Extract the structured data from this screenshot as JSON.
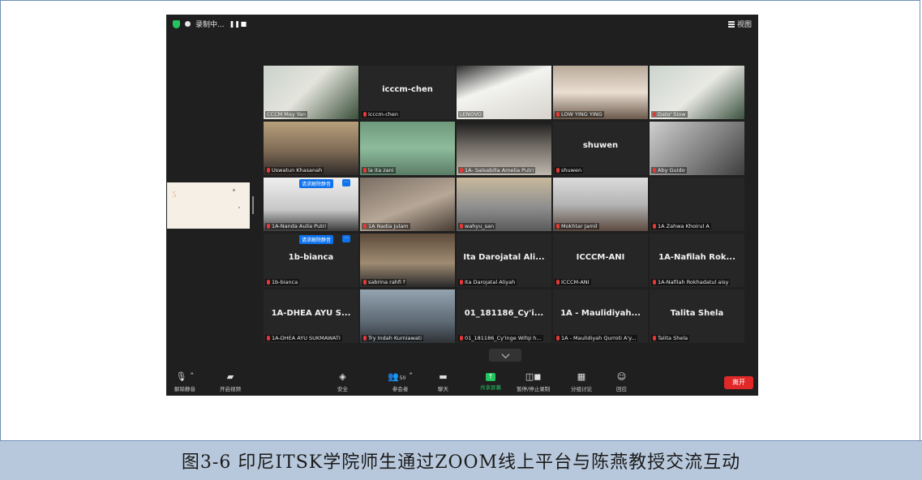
{
  "zoom": {
    "topbar": {
      "recording": "录制中...",
      "view": "视图"
    },
    "tiles": [
      {
        "name": "",
        "label": "CCCM May Yan",
        "video": "v1",
        "active": true,
        "muted": false
      },
      {
        "name": "icccm-chen",
        "label": "icccm-chen",
        "video": "",
        "muted": true
      },
      {
        "name": "",
        "label": "LENOVO",
        "video": "v2",
        "muted": false
      },
      {
        "name": "",
        "label": "LOW YING YING",
        "video": "v3",
        "muted": true
      },
      {
        "name": "",
        "label": "Dato' Siow",
        "video": "v4",
        "muted": true
      },
      {
        "name": "",
        "label": "Uswatun Khasanah",
        "video": "v5",
        "muted": true
      },
      {
        "name": "",
        "label": "la ita zani",
        "video": "v6",
        "muted": true
      },
      {
        "name": "",
        "label": "1A- Salsabilla Amelia Putri",
        "video": "v7",
        "muted": true
      },
      {
        "name": "shuwen",
        "label": "shuwen",
        "video": "",
        "muted": true
      },
      {
        "name": "",
        "label": "Aby Guido",
        "video": "v8",
        "muted": true
      },
      {
        "name": "",
        "label": "1A-Nanda Aulia Putri",
        "video": "v9",
        "muted": true,
        "badge": "请求解除静音"
      },
      {
        "name": "",
        "label": "1A Nadia Julam",
        "video": "v10",
        "muted": true
      },
      {
        "name": "",
        "label": "wahyu_san",
        "video": "v11",
        "muted": true
      },
      {
        "name": "",
        "label": "Mokhtar Jamil",
        "video": "v12",
        "muted": true
      },
      {
        "name": "",
        "label": "1A Zahwa Khoirul A",
        "video": "",
        "muted": true
      },
      {
        "name": "1b-bianca",
        "label": "1b-bianca",
        "video": "",
        "muted": true,
        "badge": "请求解除静音"
      },
      {
        "name": "",
        "label": "sabrina rahfi f",
        "video": "v13",
        "muted": true
      },
      {
        "name": "Ita Darojatal Ali...",
        "label": "Ita Darojatal Aliyah",
        "video": "",
        "muted": true
      },
      {
        "name": "ICCCM-ANI",
        "label": "ICCCM-ANI",
        "video": "",
        "muted": true
      },
      {
        "name": "1A-Nafilah Rok...",
        "label": "1A-Nafilah Rokhadatul aisy",
        "video": "",
        "muted": true
      },
      {
        "name": "1A-DHEA AYU S...",
        "label": "1A-DHEA AYU SUKMAWATI",
        "video": "",
        "muted": true
      },
      {
        "name": "",
        "label": "Try Indah Kurniawati",
        "video": "v14",
        "muted": true
      },
      {
        "name": "01_181186_Cy'i...",
        "label": "01_181186_Cy'inge Wifqi h...",
        "video": "",
        "muted": true
      },
      {
        "name": "1A - Maulidiyah...",
        "label": "1A - Maulidiyah Qurroti A'y...",
        "video": "",
        "muted": true
      },
      {
        "name": "Talita Shela",
        "label": "Talita Shela",
        "video": "",
        "muted": true
      }
    ],
    "toolbar": {
      "unmute": "解除静音",
      "start_video": "开启视频",
      "security": "安全",
      "participants": "参会者",
      "participant_count": "50",
      "chat": "聊天",
      "share_screen": "共享屏幕",
      "pause_recording": "暂停/停止录制",
      "breakout": "分组讨论",
      "reactions": "回应",
      "leave": "离开"
    }
  },
  "caption": "图3-6  印尼ITSK学院师生通过ZOOM线上平台与陈燕教授交流互动"
}
